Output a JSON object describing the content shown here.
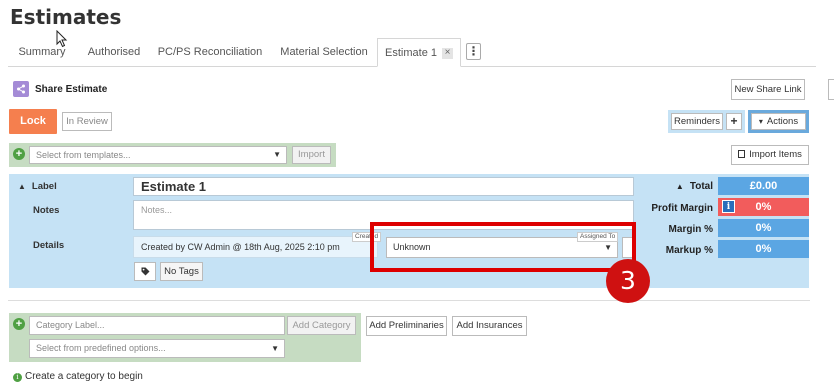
{
  "page": {
    "title": "Estimates"
  },
  "tabs": [
    {
      "label": "Summary"
    },
    {
      "label": "Authorised"
    },
    {
      "label": "PC/PS Reconciliation"
    },
    {
      "label": "Material Selection"
    },
    {
      "label": "Estimate 1",
      "active": true,
      "close_glyph": "×"
    }
  ],
  "tab_more_glyph": "⋮",
  "share": {
    "label": "Share Estimate",
    "new_link": "New Share Link"
  },
  "lock": {
    "label": "Lock",
    "status": "In Review"
  },
  "reminders": {
    "label": "Reminders",
    "add_glyph": "+"
  },
  "actions": {
    "label": "Actions",
    "caret": "▾"
  },
  "templates": {
    "placeholder": "Select from templates...",
    "import_label": "Import"
  },
  "import_items": {
    "label": "Import Items"
  },
  "estimate": {
    "label_heading": "Label",
    "label_value": "Estimate 1",
    "notes_heading": "Notes",
    "notes_placeholder": "Notes...",
    "details_heading": "Details",
    "created_tag": "Created",
    "created_text": "Created by  CW Admin @ 18th Aug, 2025 2:10 pm",
    "assigned_tag": "Assigned To",
    "assigned_value": "Unknown",
    "tags_value": "No Tags"
  },
  "summary": {
    "total_label": "Total",
    "total_value": "£0.00",
    "profit_label": "Profit Margin",
    "profit_value": "0%",
    "margin_label": "Margin %",
    "margin_value": "0%",
    "markup_label": "Markup %",
    "markup_value": "0%"
  },
  "category": {
    "placeholder": "Category Label...",
    "add_label": "Add Category",
    "predefined_placeholder": "Select from predefined options...",
    "prelim_label": "Add Preliminaries",
    "insurance_label": "Add Insurances",
    "hint": "Create a category to begin"
  },
  "annotation": {
    "number": "3"
  },
  "colors": {
    "lock": "#f57f4e",
    "panel_blue": "#c5e2f5",
    "panel_green": "#c6dcc2",
    "summary_blue": "#5ba6e3",
    "profit_red": "#f25c5c",
    "highlight_red": "#dd0000"
  }
}
